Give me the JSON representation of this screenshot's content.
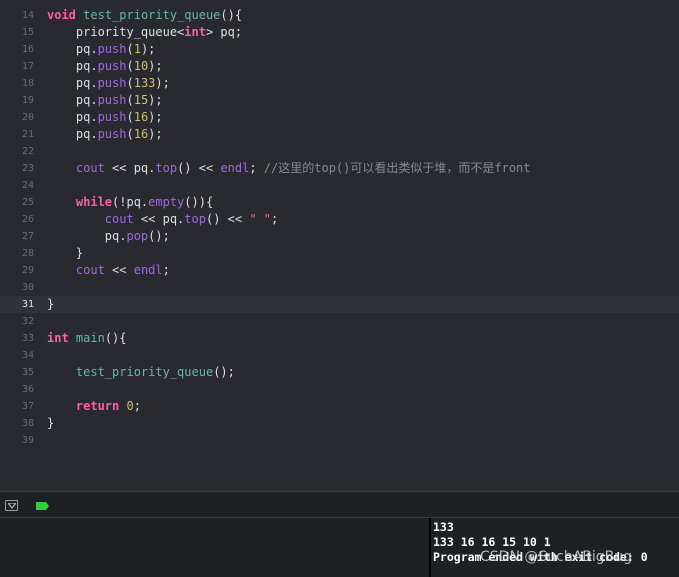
{
  "editor": {
    "current_line": "31",
    "lines": [
      {
        "num": "14",
        "tokens": [
          {
            "t": "void",
            "c": "kw"
          },
          {
            "t": " ",
            "c": "plain"
          },
          {
            "t": "test_priority_queue",
            "c": "func"
          },
          {
            "t": "(){",
            "c": "plain"
          }
        ]
      },
      {
        "num": "15",
        "tokens": [
          {
            "t": "    priority_queue<",
            "c": "plain"
          },
          {
            "t": "int",
            "c": "kw"
          },
          {
            "t": "> pq;",
            "c": "plain"
          }
        ]
      },
      {
        "num": "16",
        "tokens": [
          {
            "t": "    pq.",
            "c": "plain"
          },
          {
            "t": "push",
            "c": "method"
          },
          {
            "t": "(",
            "c": "plain"
          },
          {
            "t": "1",
            "c": "num"
          },
          {
            "t": ");",
            "c": "plain"
          }
        ]
      },
      {
        "num": "17",
        "tokens": [
          {
            "t": "    pq.",
            "c": "plain"
          },
          {
            "t": "push",
            "c": "method"
          },
          {
            "t": "(",
            "c": "plain"
          },
          {
            "t": "10",
            "c": "num"
          },
          {
            "t": ");",
            "c": "plain"
          }
        ]
      },
      {
        "num": "18",
        "tokens": [
          {
            "t": "    pq.",
            "c": "plain"
          },
          {
            "t": "push",
            "c": "method"
          },
          {
            "t": "(",
            "c": "plain"
          },
          {
            "t": "133",
            "c": "num"
          },
          {
            "t": ");",
            "c": "plain"
          }
        ]
      },
      {
        "num": "19",
        "tokens": [
          {
            "t": "    pq.",
            "c": "plain"
          },
          {
            "t": "push",
            "c": "method"
          },
          {
            "t": "(",
            "c": "plain"
          },
          {
            "t": "15",
            "c": "num"
          },
          {
            "t": ");",
            "c": "plain"
          }
        ]
      },
      {
        "num": "20",
        "tokens": [
          {
            "t": "    pq.",
            "c": "plain"
          },
          {
            "t": "push",
            "c": "method"
          },
          {
            "t": "(",
            "c": "plain"
          },
          {
            "t": "16",
            "c": "num"
          },
          {
            "t": ");",
            "c": "plain"
          }
        ]
      },
      {
        "num": "21",
        "tokens": [
          {
            "t": "    pq.",
            "c": "plain"
          },
          {
            "t": "push",
            "c": "method"
          },
          {
            "t": "(",
            "c": "plain"
          },
          {
            "t": "16",
            "c": "num"
          },
          {
            "t": ");",
            "c": "plain"
          }
        ]
      },
      {
        "num": "22",
        "tokens": []
      },
      {
        "num": "23",
        "tokens": [
          {
            "t": "    ",
            "c": "plain"
          },
          {
            "t": "cout",
            "c": "method"
          },
          {
            "t": " << pq.",
            "c": "plain"
          },
          {
            "t": "top",
            "c": "method"
          },
          {
            "t": "() << ",
            "c": "plain"
          },
          {
            "t": "endl",
            "c": "method"
          },
          {
            "t": "; ",
            "c": "plain"
          },
          {
            "t": "//这里的top()可以看出类似于堆，而不是front",
            "c": "comment"
          }
        ]
      },
      {
        "num": "24",
        "tokens": []
      },
      {
        "num": "25",
        "tokens": [
          {
            "t": "    ",
            "c": "plain"
          },
          {
            "t": "while",
            "c": "kw"
          },
          {
            "t": "(!pq.",
            "c": "plain"
          },
          {
            "t": "empty",
            "c": "method"
          },
          {
            "t": "()){",
            "c": "plain"
          }
        ]
      },
      {
        "num": "26",
        "tokens": [
          {
            "t": "        ",
            "c": "plain"
          },
          {
            "t": "cout",
            "c": "method"
          },
          {
            "t": " << pq.",
            "c": "plain"
          },
          {
            "t": "top",
            "c": "method"
          },
          {
            "t": "() << ",
            "c": "plain"
          },
          {
            "t": "\" \"",
            "c": "str"
          },
          {
            "t": ";",
            "c": "plain"
          }
        ]
      },
      {
        "num": "27",
        "tokens": [
          {
            "t": "        pq.",
            "c": "plain"
          },
          {
            "t": "pop",
            "c": "method"
          },
          {
            "t": "();",
            "c": "plain"
          }
        ]
      },
      {
        "num": "28",
        "tokens": [
          {
            "t": "    }",
            "c": "plain"
          }
        ]
      },
      {
        "num": "29",
        "tokens": [
          {
            "t": "    ",
            "c": "plain"
          },
          {
            "t": "cout",
            "c": "method"
          },
          {
            "t": " << ",
            "c": "plain"
          },
          {
            "t": "endl",
            "c": "method"
          },
          {
            "t": ";",
            "c": "plain"
          }
        ]
      },
      {
        "num": "30",
        "tokens": []
      },
      {
        "num": "31",
        "tokens": [
          {
            "t": "}",
            "c": "plain"
          }
        ]
      },
      {
        "num": "32",
        "tokens": []
      },
      {
        "num": "33",
        "tokens": [
          {
            "t": "int",
            "c": "kw"
          },
          {
            "t": " ",
            "c": "plain"
          },
          {
            "t": "main",
            "c": "func"
          },
          {
            "t": "(){",
            "c": "plain"
          }
        ]
      },
      {
        "num": "34",
        "tokens": []
      },
      {
        "num": "35",
        "tokens": [
          {
            "t": "    ",
            "c": "plain"
          },
          {
            "t": "test_priority_queue",
            "c": "func"
          },
          {
            "t": "();",
            "c": "plain"
          }
        ]
      },
      {
        "num": "36",
        "tokens": []
      },
      {
        "num": "37",
        "tokens": [
          {
            "t": "    ",
            "c": "plain"
          },
          {
            "t": "return",
            "c": "kw"
          },
          {
            "t": " ",
            "c": "plain"
          },
          {
            "t": "0",
            "c": "num"
          },
          {
            "t": ";",
            "c": "plain"
          }
        ]
      },
      {
        "num": "38",
        "tokens": [
          {
            "t": "}",
            "c": "plain"
          }
        ]
      },
      {
        "num": "39",
        "tokens": []
      }
    ]
  },
  "debug_bar": {
    "toggle_icon": "hide-debug-area-icon",
    "status_icon": "breakpoint-flag-icon",
    "status_color": "#2ecc40"
  },
  "console": {
    "lines": [
      "133",
      "133 16 16 15 10 1",
      "Program ended with exit code: 0"
    ]
  },
  "watermark": "CSDN @SuchABigBug"
}
